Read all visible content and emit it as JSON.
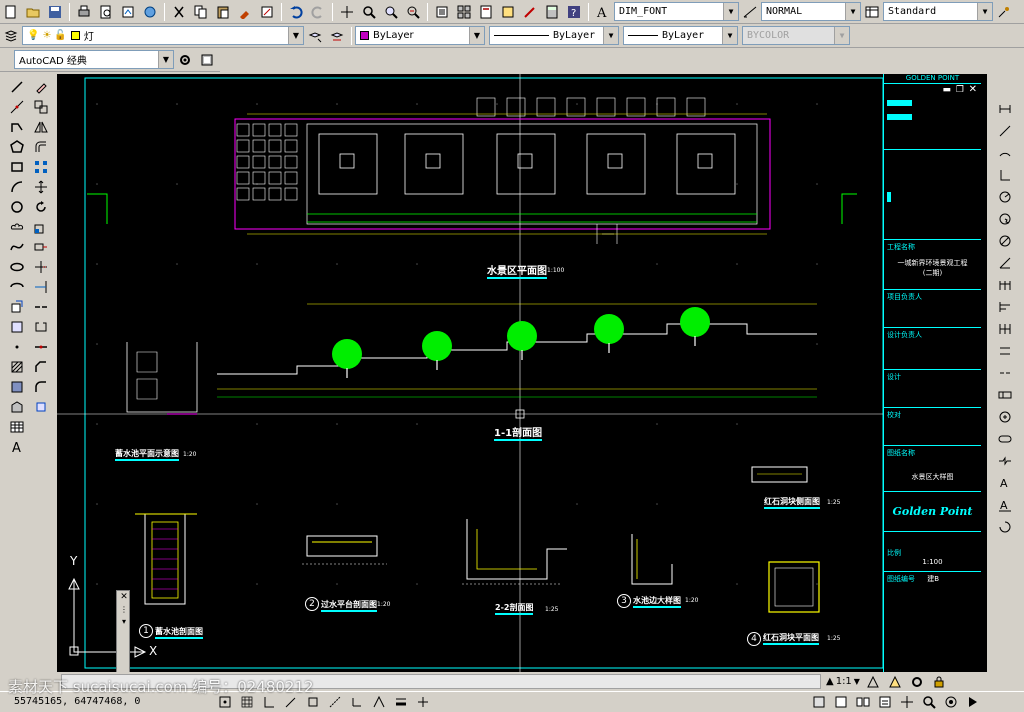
{
  "toolbar1": {
    "text_style": "DIM_FONT",
    "dim_style": "NORMAL",
    "table_style": "Standard"
  },
  "toolbar2": {
    "layer_name": "灯",
    "color": "ByLayer",
    "linetype": "ByLayer",
    "lineweight": "ByLayer",
    "plotstyle": "BYCOLOR"
  },
  "toolbar3": {
    "workspace": "AutoCAD 经典"
  },
  "drawing": {
    "titles": {
      "plan": "水景区平面图",
      "plan_scale": "1:100",
      "section": "1-1剖面图",
      "tank_plan": "蓄水池平面示意图",
      "tank_plan_scale": "1:20",
      "tank_section": "蓄水池剖面图",
      "platform_section": "过水平台剖面图",
      "platform_scale": "1:20",
      "section22": "2-2剖面图",
      "section22_scale": "1:25",
      "pool_edge": "水池边大样图",
      "pool_edge_scale": "1:20",
      "stone_side": "红石洞块侧面图",
      "stone_side_scale": "1:25",
      "stone_plan": "红石洞块平面图",
      "stone_plan_scale": "1:25"
    },
    "markers": [
      "1",
      "2",
      "3",
      "4"
    ]
  },
  "titleblock": {
    "company": "GOLDEN POINT",
    "project_label": "工程名称",
    "project_name": "一城新界环境景观工程",
    "project_phase": "(二期)",
    "manager_label": "项目负责人",
    "design_label": "设计负责人",
    "designer_label": "设计",
    "check_label": "校对",
    "drawing_label": "图纸名称",
    "drawing_name": "水景区大样图",
    "logo": "Golden Point",
    "scale_label": "比例",
    "scale_value": "1:100",
    "sheet_label": "图纸编号",
    "sheet_value": "建B"
  },
  "ucs": {
    "y": "Y",
    "x": "X"
  },
  "status": {
    "coords": "55745165, 64747468, 0",
    "scale": "1:1"
  },
  "watermark": "素材天下 sucaisucai.com   编号：02480212",
  "colors": {
    "cad_bg": "#000000",
    "green": "#00ff00",
    "cyan": "#00ffff",
    "yellow": "#ffff00",
    "magenta": "#ff00ff"
  }
}
